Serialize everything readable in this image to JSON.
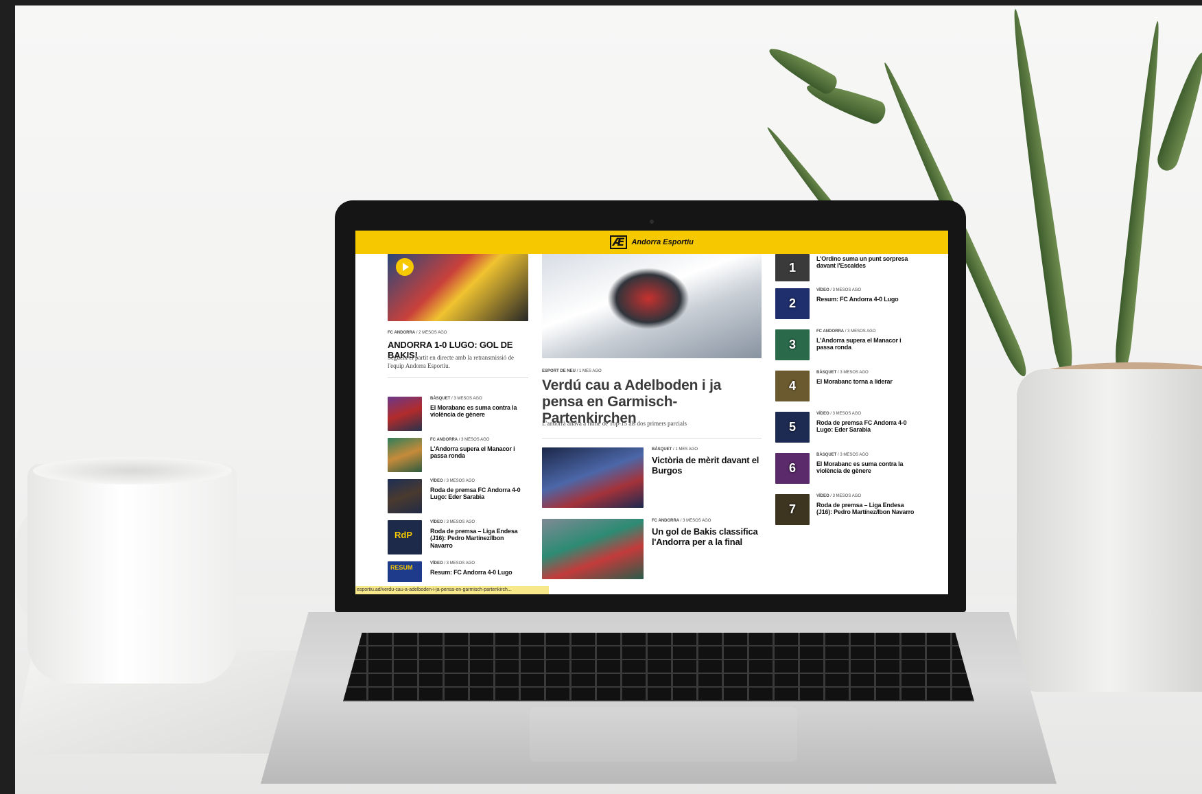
{
  "site": {
    "logo_mark": "Æ",
    "name": "Andorra Esportiu"
  },
  "status_url": "esportiu.ad/verdu-cau-a-adelboden-i-ja-pensa-en-garmisch-partenkirch...",
  "left": {
    "featured": {
      "category": "FC ANDORRA",
      "meta": "/ 2 mesos ago",
      "title": "ANDORRA 1-0 LUGO: GOL DE BAKIS!",
      "subtitle": "Segueix el partit en directe amb la retransmissió de l'equip Andorra Esportiu."
    },
    "items": [
      {
        "category": "BÀSQUET",
        "meta": "/ 3 mesos ago",
        "title": "El Morabanc es suma contra la violència de gènere"
      },
      {
        "category": "FC ANDORRA",
        "meta": "/ 3 mesos ago",
        "title": "L'Andorra supera el Manacor i passa ronda"
      },
      {
        "category": "VÍDEO",
        "meta": "/ 3 mesos ago",
        "title": "Roda de premsa FC Andorra 4-0 Lugo: Eder Sarabia"
      },
      {
        "category": "VÍDEO",
        "meta": "/ 3 mesos ago",
        "title": "Roda de premsa – Liga Endesa (J16): Pedro Martínez/Ibon Navarro"
      },
      {
        "category": "VÍDEO",
        "meta": "/ 3 mesos ago",
        "title": "Resum: FC Andorra 4-0 Lugo"
      }
    ]
  },
  "center": {
    "main": {
      "category": "ESPORT DE NEU",
      "meta": "/ 1 mes ago",
      "title": "Verdú cau a Adelboden i ja pensa en Garmisch-Partenkirchen",
      "subtitle": "L'andorrà anava a ritme de Top-15 als dos primers parcials"
    },
    "items": [
      {
        "category": "BÀSQUET",
        "meta": "/ 1 mes ago",
        "title": "Victòria de mèrit davant el Burgos"
      },
      {
        "category": "FC ANDORRA",
        "meta": "/ 3 mesos ago",
        "title": "Un gol de Bakis classifica l'Andorra per a la final"
      }
    ]
  },
  "right": {
    "items": [
      {
        "number": "1",
        "category": "",
        "meta": "",
        "title": "L'Ordino suma un punt sorpresa davant l'Escaldes"
      },
      {
        "number": "2",
        "category": "VÍDEO",
        "meta": "/ 3 mesos ago",
        "title": "Resum: FC Andorra 4-0 Lugo"
      },
      {
        "number": "3",
        "category": "FC ANDORRA",
        "meta": "/ 3 mesos ago",
        "title": "L'Andorra supera el Manacor i passa ronda"
      },
      {
        "number": "4",
        "category": "BÀSQUET",
        "meta": "/ 3 mesos ago",
        "title": "El Morabanc torna a liderar"
      },
      {
        "number": "5",
        "category": "VÍDEO",
        "meta": "/ 3 mesos ago",
        "title": "Roda de premsa FC Andorra 4-0 Lugo: Eder Sarabia"
      },
      {
        "number": "6",
        "category": "BÀSQUET",
        "meta": "/ 3 mesos ago",
        "title": "El Morabanc es suma contra la violència de gènere"
      },
      {
        "number": "7",
        "category": "VÍDEO",
        "meta": "/ 3 mesos ago",
        "title": "Roda de premsa – Liga Endesa (J16): Pedro Martínez/Ibon Navarro"
      }
    ]
  },
  "thumb_badges": {
    "rdp": "RdP",
    "resum": "RESUM"
  },
  "colors": {
    "header": "#f5c800",
    "text": "#111111",
    "status_bar": "#f7e98a"
  }
}
